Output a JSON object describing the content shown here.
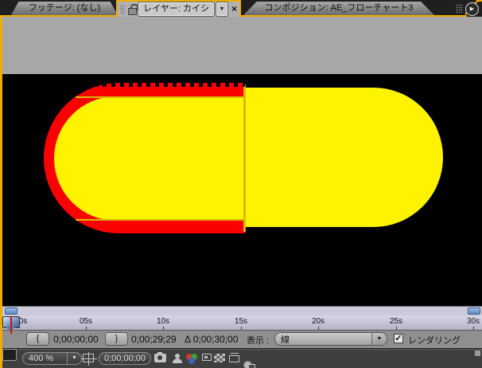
{
  "accent_color": "#EFAC00",
  "tab_bar": {
    "footage_tab": "フッテージ: (なし)",
    "layer_tab": "レイヤー: カイシ",
    "composition_tab": "コンポジション: AE_フローチャート3",
    "close_glyph": "×",
    "dropdown_glyph": "▼",
    "panel_menu_glyph": "▶"
  },
  "viewer": {
    "background_color": "#000000",
    "shape_fill_color": "#FFF300",
    "stroke_color": "#FB0000",
    "mask_line_color": "#D9B900"
  },
  "timeline": {
    "ruler_labels": [
      "0s",
      "05s",
      "10s",
      "15s",
      "20s",
      "25s",
      "30s"
    ],
    "in_button_glyph": "{",
    "out_button_glyph": "}",
    "in_time": "0;00;00;00",
    "out_time": "0;00;29;29",
    "duration": "Δ 0;00;30;00",
    "view_label": "表示 :",
    "view_value": "線",
    "view_dropdown_glyph": "▼",
    "render_label": "レンダリング",
    "render_checked": "✓"
  },
  "status_bar": {
    "zoom_value": "400 %",
    "zoom_dropdown_glyph": "▼",
    "current_time": "0;00;00;00"
  }
}
